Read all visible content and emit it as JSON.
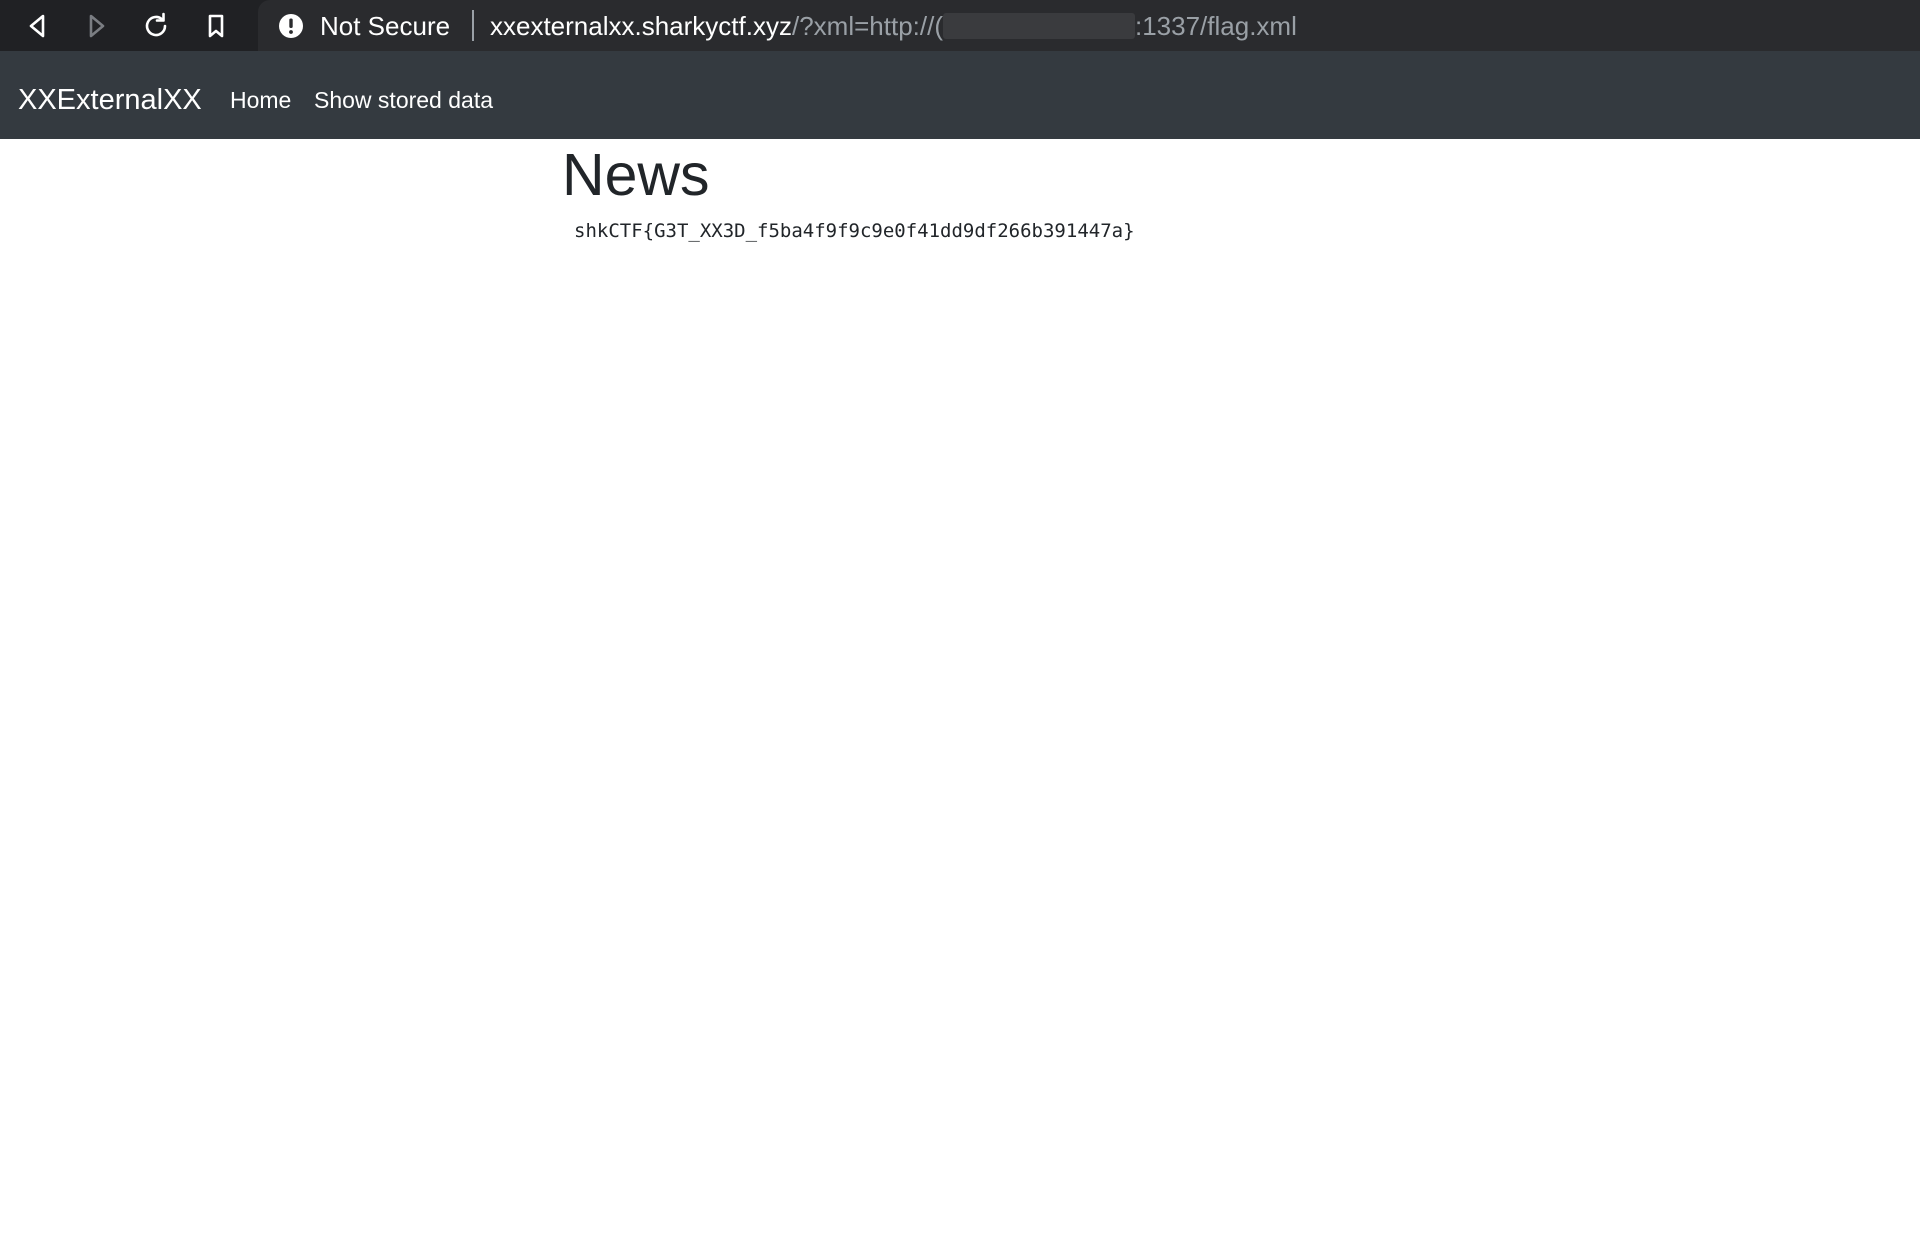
{
  "browser": {
    "security_label": "Not Secure",
    "url_host": "xxexternalxx.sharkyctf.xyz",
    "url_path_start": "/?xml=http://(",
    "url_path_end": ":1337/flag.xml"
  },
  "navbar": {
    "brand": "XXExternalXX",
    "links": [
      {
        "label": "Home"
      },
      {
        "label": "Show stored data"
      }
    ]
  },
  "main": {
    "title": "News",
    "flag": "shkCTF{G3T_XX3D_f5ba4f9f9c9e0f41dd9df266b391447a}"
  },
  "colors": {
    "browser_bar": "#202124",
    "navbar_bg": "#343a40",
    "text_dark": "#212529"
  }
}
